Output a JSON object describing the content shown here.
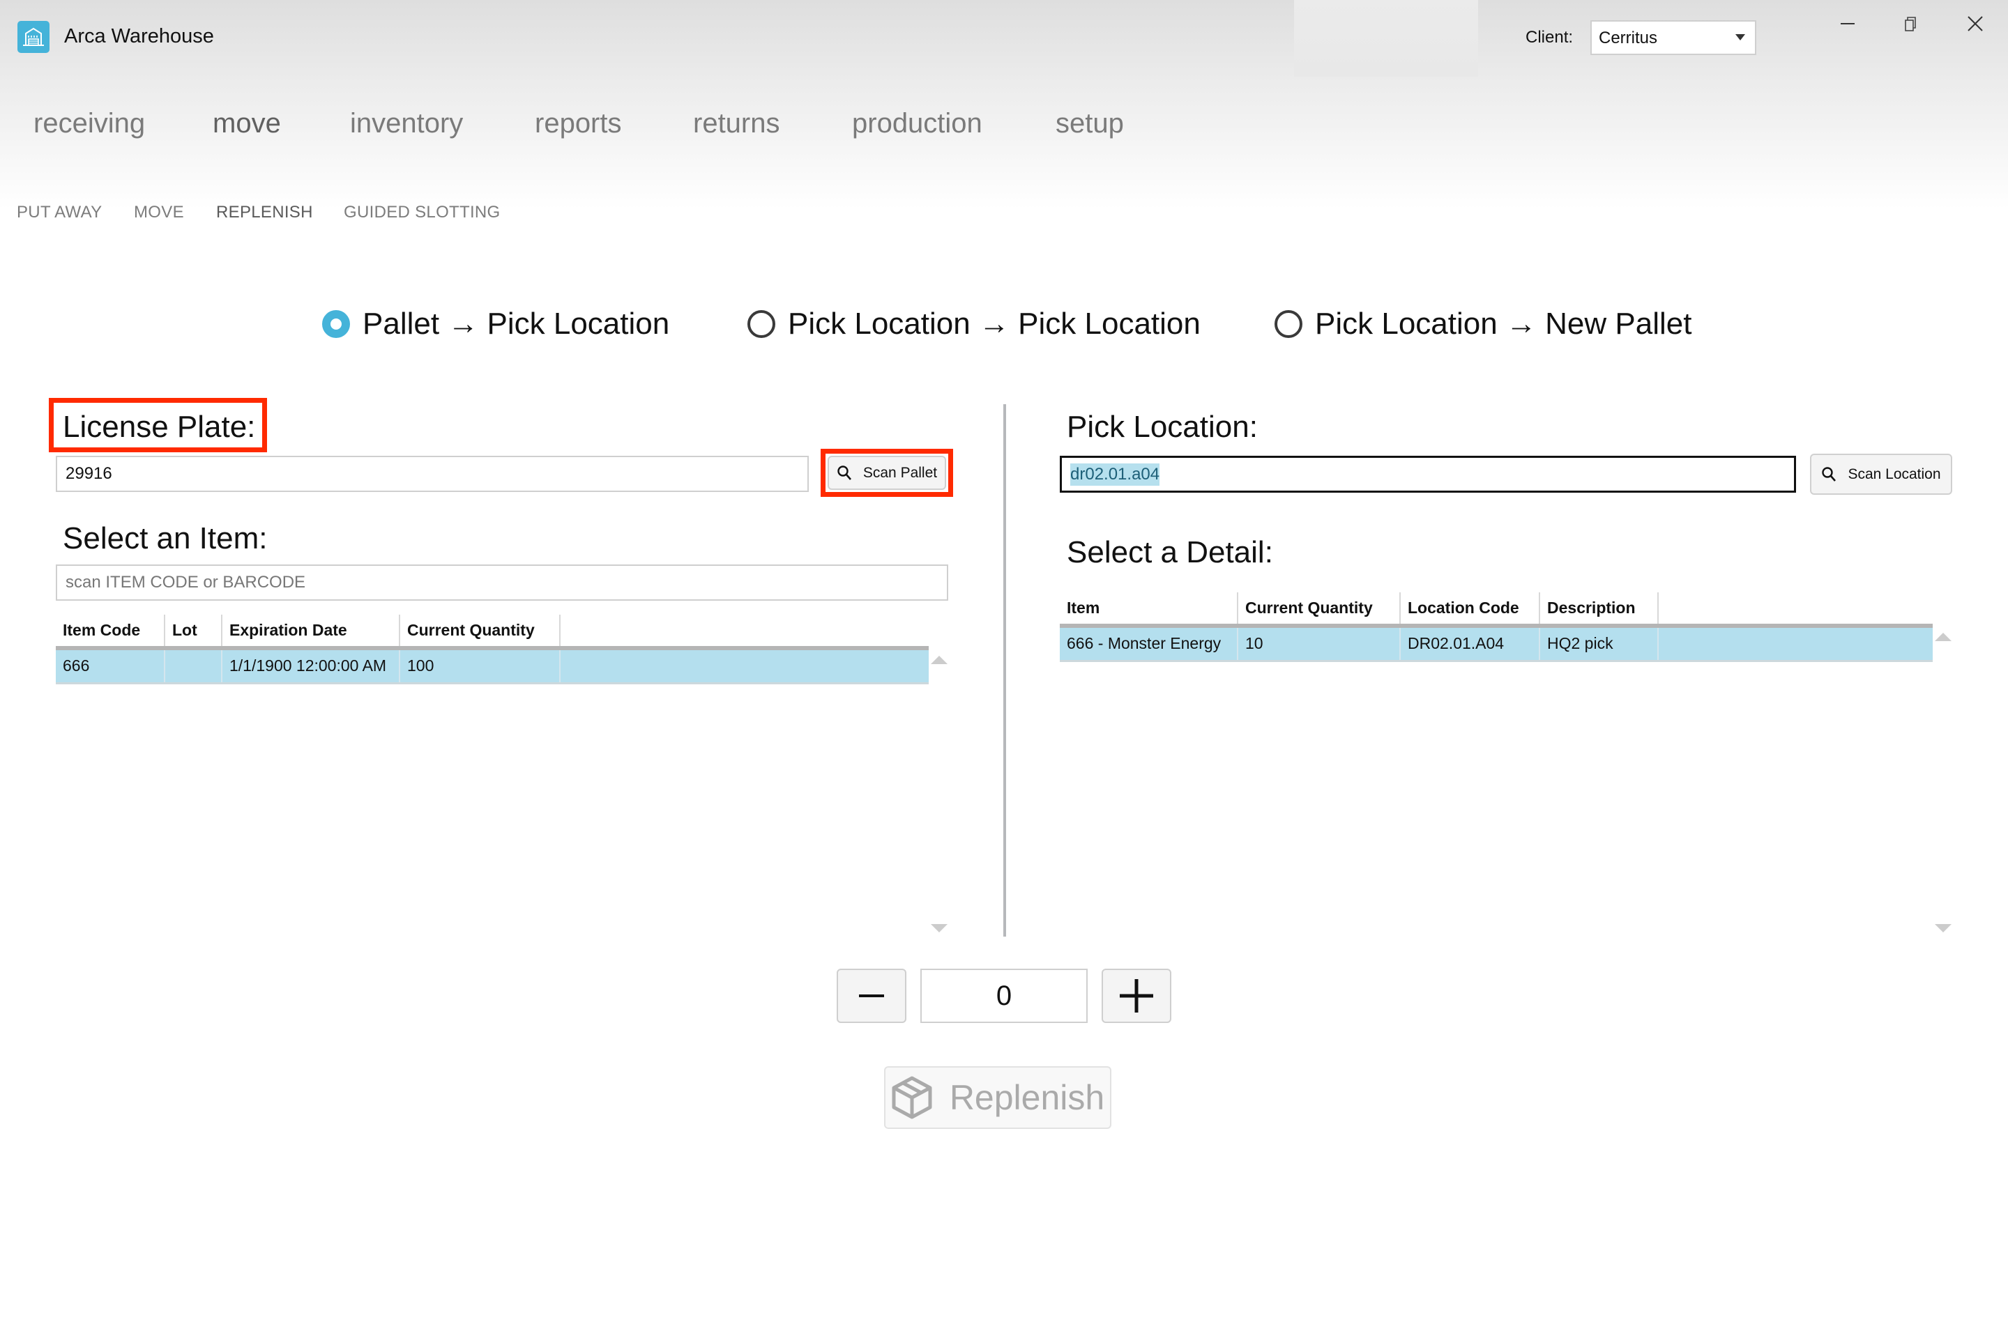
{
  "app": {
    "title": "Arca Warehouse",
    "client_label": "Client:",
    "client_value": "Cerritus"
  },
  "nav": {
    "items": [
      {
        "label": "receiving"
      },
      {
        "label": "move",
        "active": true
      },
      {
        "label": "inventory"
      },
      {
        "label": "reports"
      },
      {
        "label": "returns"
      },
      {
        "label": "production"
      },
      {
        "label": "setup"
      }
    ]
  },
  "subnav": {
    "items": [
      {
        "label": "PUT AWAY"
      },
      {
        "label": "MOVE"
      },
      {
        "label": "REPLENISH",
        "active": true
      },
      {
        "label": "GUIDED SLOTTING"
      }
    ]
  },
  "modes": [
    {
      "label": "Pallet → Pick Location",
      "checked": true
    },
    {
      "label": "Pick Location → Pick Location",
      "checked": false
    },
    {
      "label": "Pick Location → New Pallet",
      "checked": false
    }
  ],
  "left": {
    "license_label": "License Plate:",
    "license_value": "29916",
    "scan_pallet_label": "Scan Pallet",
    "select_item_label": "Select an Item:",
    "item_search_placeholder": "scan ITEM CODE or BARCODE",
    "table": {
      "columns": [
        "Item Code",
        "Lot",
        "Expiration Date",
        "Current Quantity"
      ],
      "rows": [
        [
          "666",
          "",
          "1/1/1900 12:00:00 AM",
          "100"
        ]
      ]
    }
  },
  "right": {
    "pick_location_label": "Pick Location:",
    "pick_location_value": "dr02.01.a04",
    "scan_location_label": "Scan Location",
    "select_detail_label": "Select a Detail:",
    "table": {
      "columns": [
        "Item",
        "Current Quantity",
        "Location Code",
        "Description"
      ],
      "rows": [
        [
          "666 - Monster Energy",
          "10",
          "DR02.01.A04",
          "HQ2 pick"
        ]
      ]
    }
  },
  "quantity": {
    "value": "0"
  },
  "actions": {
    "replenish_label": "Replenish"
  },
  "colors": {
    "accent": "#45b3d9",
    "selected_row": "#b4dfee",
    "highlight_box": "#ff2a00"
  }
}
